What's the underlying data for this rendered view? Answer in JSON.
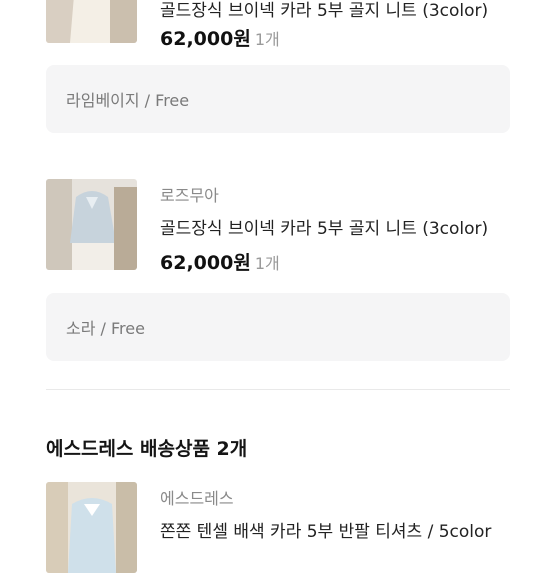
{
  "items": [
    {
      "brand": "",
      "name": "골드장식 브이넥 카라 5부 골지 니트 (3color)",
      "price": "62,000원",
      "qty": "1개",
      "option": "라임베이지 / Free"
    },
    {
      "brand": "로즈무아",
      "name": "골드장식 브이넥 카라 5부 골지 니트 (3color)",
      "price": "62,000원",
      "qty": "1개",
      "option": "소라 / Free"
    },
    {
      "brand": "에스드레스",
      "name": "쫀쫀 텐셀 배색 카라 5부 반팔 티셔츠 / 5color"
    }
  ],
  "section": {
    "title": "에스드레스 배송상품 2개"
  }
}
